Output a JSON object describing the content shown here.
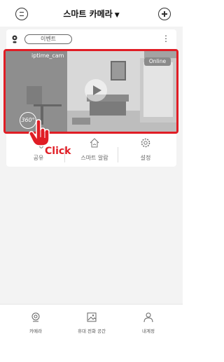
{
  "header": {
    "title": "스마트 카메라",
    "dropdown_glyph": "▼",
    "menu_icon": "menu-circle-icon",
    "add_icon": "plus-circle-icon"
  },
  "camera_card": {
    "event_label": "이벤트",
    "more_glyph": "⋮",
    "camera_name": "iptime_cam",
    "status": "Online",
    "badge_360": "360°",
    "actions": [
      {
        "label": "공유",
        "icon": "share-icon"
      },
      {
        "label": "스마트 알람",
        "icon": "home-alarm-icon"
      },
      {
        "label": "설정",
        "icon": "gear-icon"
      }
    ]
  },
  "overlay": {
    "click_label": "Click",
    "pointer_icon": "hand-pointer-icon"
  },
  "bottom_nav": {
    "items": [
      {
        "label": "카메라",
        "icon": "camera-icon"
      },
      {
        "label": "휴대 전화 공간",
        "icon": "image-icon"
      },
      {
        "label": "내계정",
        "icon": "person-icon"
      }
    ]
  },
  "colors": {
    "highlight": "#e01d25",
    "background": "#f3f3f3",
    "card": "#ffffff"
  }
}
